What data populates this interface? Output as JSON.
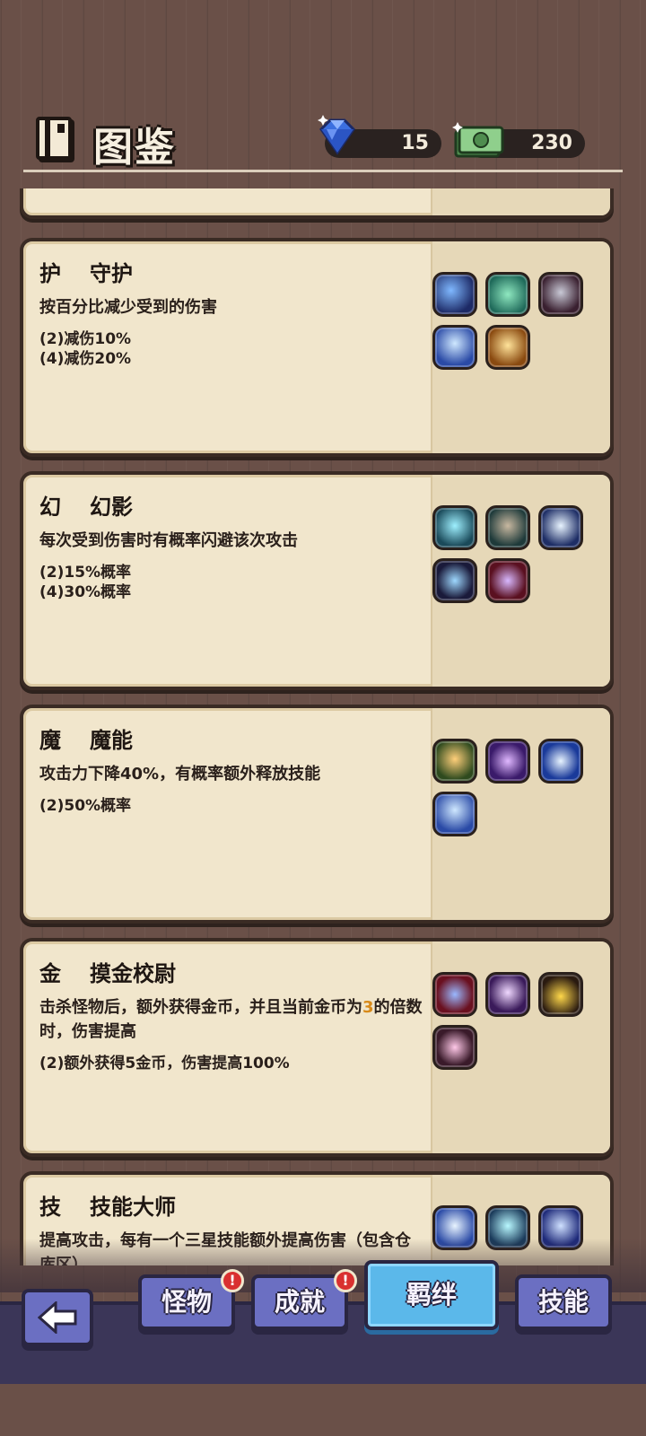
{
  "header": {
    "title": "图鉴",
    "gems": "15",
    "cash": "230"
  },
  "cards": [
    {
      "badge": "护",
      "name": "守护",
      "desc": "按百分比减少受到的伤害",
      "bonuses": [
        "(2)减伤10%",
        "(4)减伤20%"
      ],
      "icons": [
        "blue-sword-skill-icon",
        "green-orb-skill-icon",
        "silver-disc-skill-icon",
        "ice-flame-skill-icon",
        "gold-flame-skill-icon"
      ]
    },
    {
      "badge": "幻",
      "name": "幻影",
      "desc": "每次受到伤害时有概率闪避该次攻击",
      "bonuses": [
        "(2)15%概率",
        "(4)30%概率"
      ],
      "icons": [
        "lightning-bolt-skill-icon",
        "phantom-missile-skill-icon",
        "shatter-burst-skill-icon",
        "ghost-ring-skill-icon",
        "crimson-vortex-skill-icon"
      ]
    },
    {
      "badge": "魔",
      "name": "魔能",
      "desc": "攻击力下降40%，有概率额外释放技能",
      "bonuses": [
        "(2)50%概率"
      ],
      "icons": [
        "fire-staff-skill-icon",
        "purple-galaxy-skill-icon",
        "blue-vortex-skill-icon",
        "ice-flame-skill-icon"
      ]
    },
    {
      "badge": "金",
      "name": "摸金校尉",
      "desc_prefix": "击杀怪物后，额外获得金币，并且当前金币为",
      "desc_highlight": "3",
      "desc_suffix": "的倍数时，伤害提高",
      "bonuses": [
        "(2)额外获得5金币，伤害提高100%"
      ],
      "icons": [
        "shuriken-skill-icon",
        "purple-wing-skill-icon",
        "gold-coin-skill-icon",
        "pink-spiral-skill-icon"
      ]
    },
    {
      "badge": "技",
      "name": "技能大师",
      "desc": "提高攻击，每有一个三星技能额外提高伤害（包含仓库区）",
      "bonuses": [],
      "icons": [
        "crystal-shard-skill-icon",
        "ice-crystal-skill-icon",
        "blue-spear-skill-icon"
      ]
    }
  ],
  "bottom_nav": {
    "tab_monsters": "怪物",
    "tab_achievements": "成就",
    "tab_bonds": "羁绊",
    "tab_skills": "技能",
    "alert": "!"
  },
  "colors": {
    "card_bg": "#f1e6cc",
    "card_border": "#3a2b24",
    "tab_idle": "#6b6fc2",
    "tab_active": "#5bb8ea",
    "highlight": "#d88a1a",
    "alert": "#d93030"
  }
}
